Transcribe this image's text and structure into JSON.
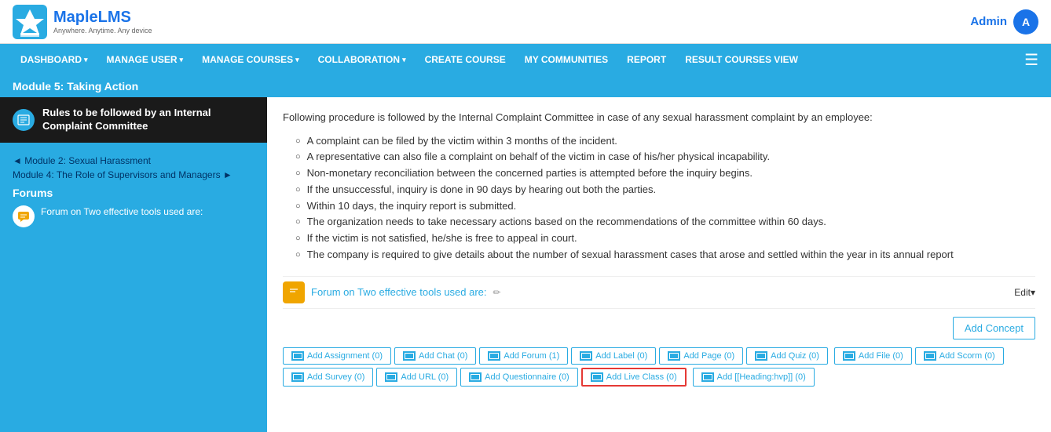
{
  "header": {
    "logo_name": "MapleLMS",
    "logo_tagline": "Anywhere. Anytime. Any device",
    "admin_label": "Admin",
    "admin_initial": "A"
  },
  "nav": {
    "items": [
      {
        "label": "DASHBOARD",
        "has_arrow": true
      },
      {
        "label": "MANAGE USER",
        "has_arrow": true
      },
      {
        "label": "MANAGE COURSES",
        "has_arrow": true
      },
      {
        "label": "COLLABORATION",
        "has_arrow": true
      },
      {
        "label": "CREATE COURSE",
        "has_arrow": false
      },
      {
        "label": "MY COMMUNITIES",
        "has_arrow": false
      },
      {
        "label": "REPORT",
        "has_arrow": false
      },
      {
        "label": "RESULT COURSES VIEW",
        "has_arrow": false
      }
    ]
  },
  "sub_header": {
    "title": "Module 5: Taking Action"
  },
  "sidebar": {
    "active_item_text": "Rules to be followed by an Internal Complaint Committee",
    "nav_links": [
      {
        "label": "◄ Module 2: Sexual Harassment",
        "id": "link-module2"
      },
      {
        "label": "Module 4: The Role of Supervisors and Managers ►",
        "id": "link-module4"
      }
    ],
    "forums_title": "Forums",
    "forum_item_text": "Forum on Two effective tools used are:"
  },
  "content": {
    "intro": "Following procedure is followed by the Internal Complaint Committee in case of any sexual harassment complaint by an employee:",
    "list_items": [
      "A complaint can be filed by the victim within 3 months of the incident.",
      "A representative can also file a complaint on behalf of the victim in case of his/her physical incapability.",
      "Non-monetary reconciliation between the concerned parties is attempted before the inquiry begins.",
      "If the unsuccessful, inquiry is done in 90 days by hearing out both the parties.",
      "Within 10 days, the inquiry report is submitted.",
      "The organization needs to take necessary actions based on the recommendations of the committee within 60 days.",
      "If the victim is not satisfied, he/she is free to appeal in court.",
      "The company is required to give details about the number of sexual harassment cases that arose and settled within the year in its annual report"
    ],
    "forum_bar_text": "Forum on Two effective tools used are:",
    "edit_label": "Edit▾",
    "add_concept_label": "Add Concept",
    "action_buttons": [
      {
        "label": "Add Assignment (0)",
        "highlighted": false
      },
      {
        "label": "Add Chat (0)",
        "highlighted": false
      },
      {
        "label": "Add Forum (1)",
        "highlighted": false
      },
      {
        "label": "Add Label (0)",
        "highlighted": false
      },
      {
        "label": "Add Page (0)",
        "highlighted": false
      },
      {
        "label": "Add Quiz (0)",
        "highlighted": false
      },
      {
        "label": "Add File (0)",
        "highlighted": false
      },
      {
        "label": "Add Scorm (0)",
        "highlighted": false
      },
      {
        "label": "Add Survey (0)",
        "highlighted": false
      },
      {
        "label": "Add URL (0)",
        "highlighted": false
      },
      {
        "label": "Add Questionnaire (0)",
        "highlighted": false
      },
      {
        "label": "Add Live Class (0)",
        "highlighted": true
      },
      {
        "label": "Add [[Heading:hvp]] (0)",
        "highlighted": false
      }
    ]
  }
}
